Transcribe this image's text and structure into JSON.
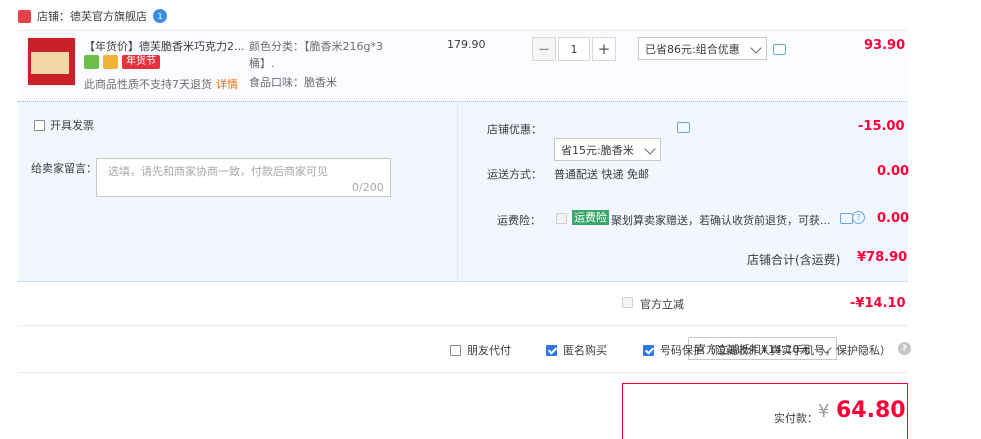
{
  "shop": {
    "label": "店铺：德芙官方旗舰店",
    "badge": "1"
  },
  "item": {
    "title": "【年货价】德芙脆香米巧克力2...",
    "fest_tag": "年货节",
    "no_return": "此商品性质不支持7天退货",
    "detail_link": "详情",
    "attr_color": "颜色分类：【脆香米216g*3桶】.",
    "attr_flavor": "食品口味：脆香米",
    "unit_price": "179.90",
    "quantity": "1",
    "promo_select": "已省86元:组合优惠",
    "subtotal": "93.90"
  },
  "options": {
    "invoice_label": "开具发票",
    "message_label": "给卖家留言：",
    "message_placeholder": "选填，请先和商家协商一致，付款后商家可见",
    "message_count": "0/200",
    "shop_discount_label": "店铺优惠：",
    "shop_discount_select": "省15元:脆香米",
    "shop_discount_value": "-15.00",
    "shipping_label": "运送方式：",
    "shipping_value": "普通配送 快递 免邮",
    "shipping_price": "0.00",
    "insurance_label": "运费险：",
    "insurance_badge": "运费险",
    "insurance_text": "聚划算卖家赠送，若确认收货前退货，可获...",
    "insurance_price": "0.00",
    "shop_total_label": "店铺合计(含运费)",
    "shop_total_value": "¥78.90"
  },
  "official": {
    "label": "官方立减",
    "select": "官方立减抵扣¥14.10元",
    "value": "-¥14.10"
  },
  "privacy": {
    "friend_pay": "朋友代付",
    "anonymous": "匿名购买",
    "number_protect": "号码保护（隐藏收件人真实手机号，保护隐私）",
    "help": "?"
  },
  "payment": {
    "label": "实付款：",
    "currency": "¥",
    "amount": "64.80"
  },
  "colors": {
    "accent_red": "#ff0036",
    "blue_panel": "#f2f7ff"
  }
}
